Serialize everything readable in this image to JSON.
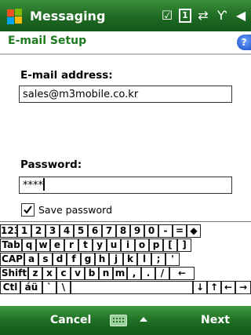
{
  "titlebar": {
    "app_title": "Messaging",
    "icons": [
      "checkbox-icon",
      "one-icon",
      "sync-icon",
      "signal-icon",
      "volume-icon"
    ]
  },
  "subheader": {
    "title": "E-mail Setup",
    "help": "?"
  },
  "form": {
    "email_label": "E-mail address:",
    "email_value": "sales@m3mobile.co.kr",
    "password_label": "Password:",
    "password_value": "****",
    "save_password_label": "Save password",
    "save_password_checked": true
  },
  "keyboard": {
    "rows": [
      [
        "123",
        "1",
        "2",
        "3",
        "4",
        "5",
        "6",
        "7",
        "8",
        "9",
        "0",
        "-",
        "=",
        "◆"
      ],
      [
        "Tab",
        "q",
        "w",
        "e",
        "r",
        "t",
        "y",
        "u",
        "i",
        "o",
        "p",
        "[",
        "]"
      ],
      [
        "CAP",
        "a",
        "s",
        "d",
        "f",
        "g",
        "h",
        "j",
        "k",
        "l",
        ";",
        "'"
      ],
      [
        "Shift",
        "z",
        "x",
        "c",
        "v",
        "b",
        "n",
        "m",
        ",",
        ".",
        "/",
        "←"
      ],
      [
        "Ctl",
        "áü",
        "`",
        "\\",
        "",
        "↓",
        "↑",
        "←",
        "→"
      ]
    ]
  },
  "softkeys": {
    "left": "Cancel",
    "right": "Next"
  },
  "colors": {
    "bar_green": "#1e6a23",
    "title_green": "#1f7a1f"
  }
}
